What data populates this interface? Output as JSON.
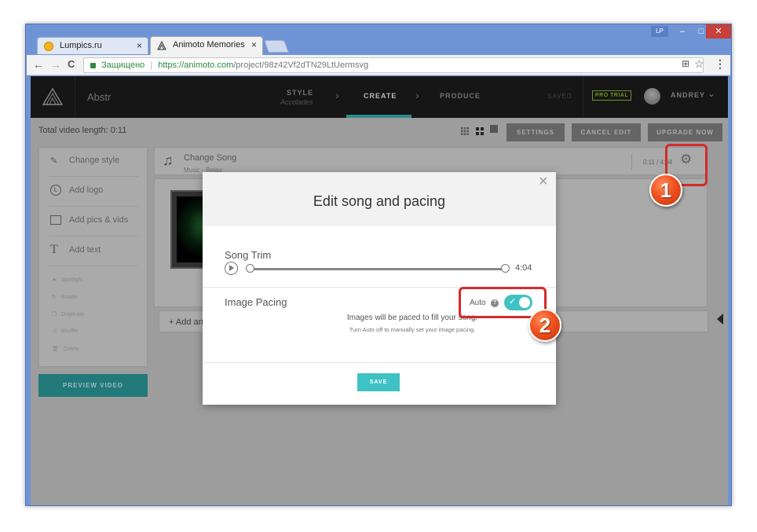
{
  "browser": {
    "tabs": [
      {
        "title": "Lumpics.ru",
        "close": "×"
      },
      {
        "title": "Animoto Memories",
        "close": "×"
      }
    ],
    "user_badge": "LP",
    "window_controls": {
      "minimize": "–",
      "maximize": "□",
      "close": "✕"
    },
    "secure_label": "Защищено",
    "url_host": "https://animoto.com",
    "url_path": "/project/98z42Vf2dTN29LtUermsvg",
    "icons": {
      "back": "←",
      "forward": "→",
      "reload": "C",
      "translate": "⊞",
      "star": "☆",
      "menu": "⋮"
    }
  },
  "app": {
    "project_name": "Abstr",
    "steps": {
      "style": "STYLE",
      "style_sub": "Accolades",
      "create": "CREATE",
      "produce": "PRODUCE",
      "arrow": "›"
    },
    "saved": "SAVED",
    "pro_trial": "PRO TRIAL",
    "user_name": "ANDREY",
    "total_length": "Total video length: 0:11",
    "buttons": {
      "settings": "SETTINGS",
      "cancel_edit": "CANCEL EDIT",
      "upgrade": "UPGRADE NOW",
      "preview": "PREVIEW VIDEO"
    },
    "sidebar": {
      "items": [
        {
          "label": "Change style",
          "icon": "brush-icon"
        },
        {
          "label": "Add logo",
          "icon": "logo-icon"
        },
        {
          "label": "Add pics & vids",
          "icon": "pics-icon"
        },
        {
          "label": "Add text",
          "icon": "text-icon"
        }
      ],
      "small_items": [
        "Spotlight",
        "Rotate",
        "Duplicate",
        "Shuffle",
        "Delete"
      ]
    },
    "song_row": {
      "title": "Change Song",
      "subtitle": "Music - Relax",
      "length": "0:11 / 4:04"
    },
    "add_text": "+ Add an"
  },
  "modal": {
    "title": "Edit song and pacing",
    "close": "×",
    "song_trim_label": "Song Trim",
    "song_end_time": "4:04",
    "image_pacing_label": "Image Pacing",
    "auto_label": "Auto",
    "auto_enabled": true,
    "help_icon": "?",
    "pacing_line1": "Images will be paced to fill your song.",
    "pacing_line2": "Turn Auto off to manually set your image pacing.",
    "save": "SAVE"
  },
  "callouts": [
    "1",
    "2"
  ],
  "colors": {
    "accent": "#3fc2c4",
    "callout_red": "#d62a2a",
    "appbar": "#1f1f1f",
    "pro_trial": "#9acd32"
  }
}
